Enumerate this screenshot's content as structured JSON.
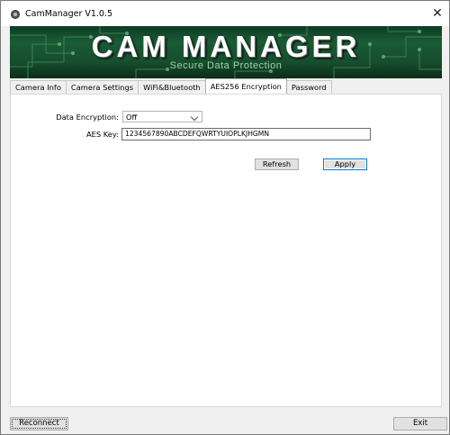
{
  "window": {
    "title": "CamManager V1.0.5",
    "close_glyph": "✕"
  },
  "banner": {
    "title": "CAM MANAGER",
    "subtitle": "Secure Data Protection"
  },
  "tabs": [
    {
      "label": "Camera Info",
      "active": false
    },
    {
      "label": "Camera Settings",
      "active": false
    },
    {
      "label": "WiFi&Bluetooth",
      "active": false
    },
    {
      "label": "AES256 Encryption",
      "active": true
    },
    {
      "label": "Password",
      "active": false
    }
  ],
  "encryption": {
    "data_encryption_label": "Data Encryption:",
    "data_encryption_value": "Off",
    "aes_key_label": "AES Key:",
    "aes_key_value": "1234567890ABCDEFQWRTYUIOPLKJHGMN",
    "refresh_label": "Refresh",
    "apply_label": "Apply"
  },
  "footer": {
    "reconnect_label": "Reconnect",
    "exit_label": "Exit"
  },
  "icons": {
    "app_icon": "camera-icon",
    "close_icon": "close-icon",
    "dropdown_icon": "chevron-down-icon"
  },
  "colors": {
    "banner_dark": "#0f3a23",
    "banner_mid": "#1a5b35",
    "subtitle": "#9fd5a8",
    "default_button_border": "#0078d7"
  }
}
